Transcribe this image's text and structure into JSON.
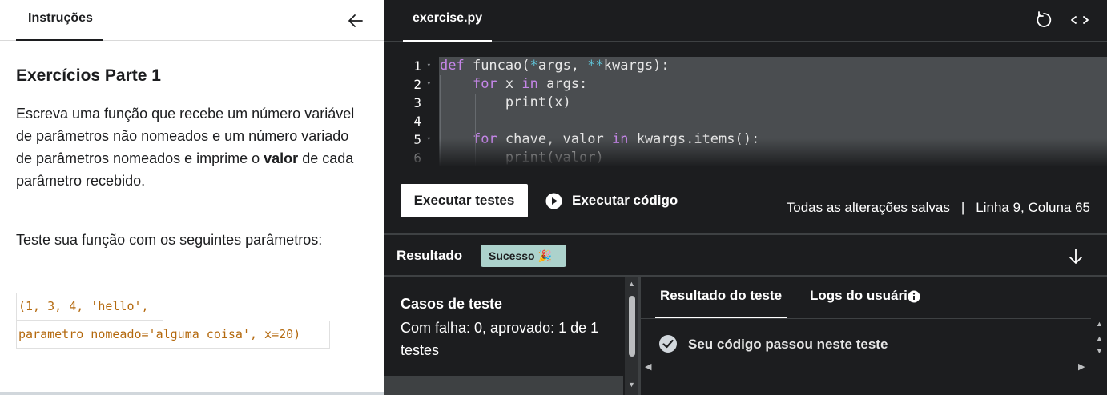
{
  "instructions": {
    "tab_label": "Instruções",
    "title": "Exercícios Parte 1",
    "desc_before": "Escreva uma função que recebe um número variável de parâmetros não nomeados e um número variado de parâmetros nomeados e imprime o ",
    "desc_bold": "valor",
    "desc_after": " de cada parâmetro recebido.",
    "test_text": "Teste sua função com os seguintes parâmetros:",
    "code_line1": "(1, 3, 4, 'hello',",
    "code_line2": "parametro_nomeado='alguma coisa', x=20)",
    "icons": {
      "back": "arrow-left-icon"
    }
  },
  "editor": {
    "file_name": "exercise.py",
    "line_numbers": [
      "1",
      "2",
      "3",
      "4",
      "5",
      "6"
    ],
    "icons": {
      "reset": "reset-icon",
      "expand": "expand-icon"
    }
  },
  "actions": {
    "run_tests": "Executar testes",
    "run_code": "Executar código",
    "saved_text": "Todas as alterações salvas",
    "separator": "|",
    "cursor_position": "Linha 9, Coluna 65"
  },
  "result": {
    "label": "Resultado",
    "badge": "Sucesso 🎉",
    "badge_color": "#acd2cc"
  },
  "tests": {
    "title": "Casos de teste",
    "summary": "Com falha: 0, aprovado: 1 de 1 testes"
  },
  "output": {
    "tab_result": "Resultado do teste",
    "tab_logs": "Logs do usuário",
    "passed_message": "Seu código passou neste teste"
  }
}
